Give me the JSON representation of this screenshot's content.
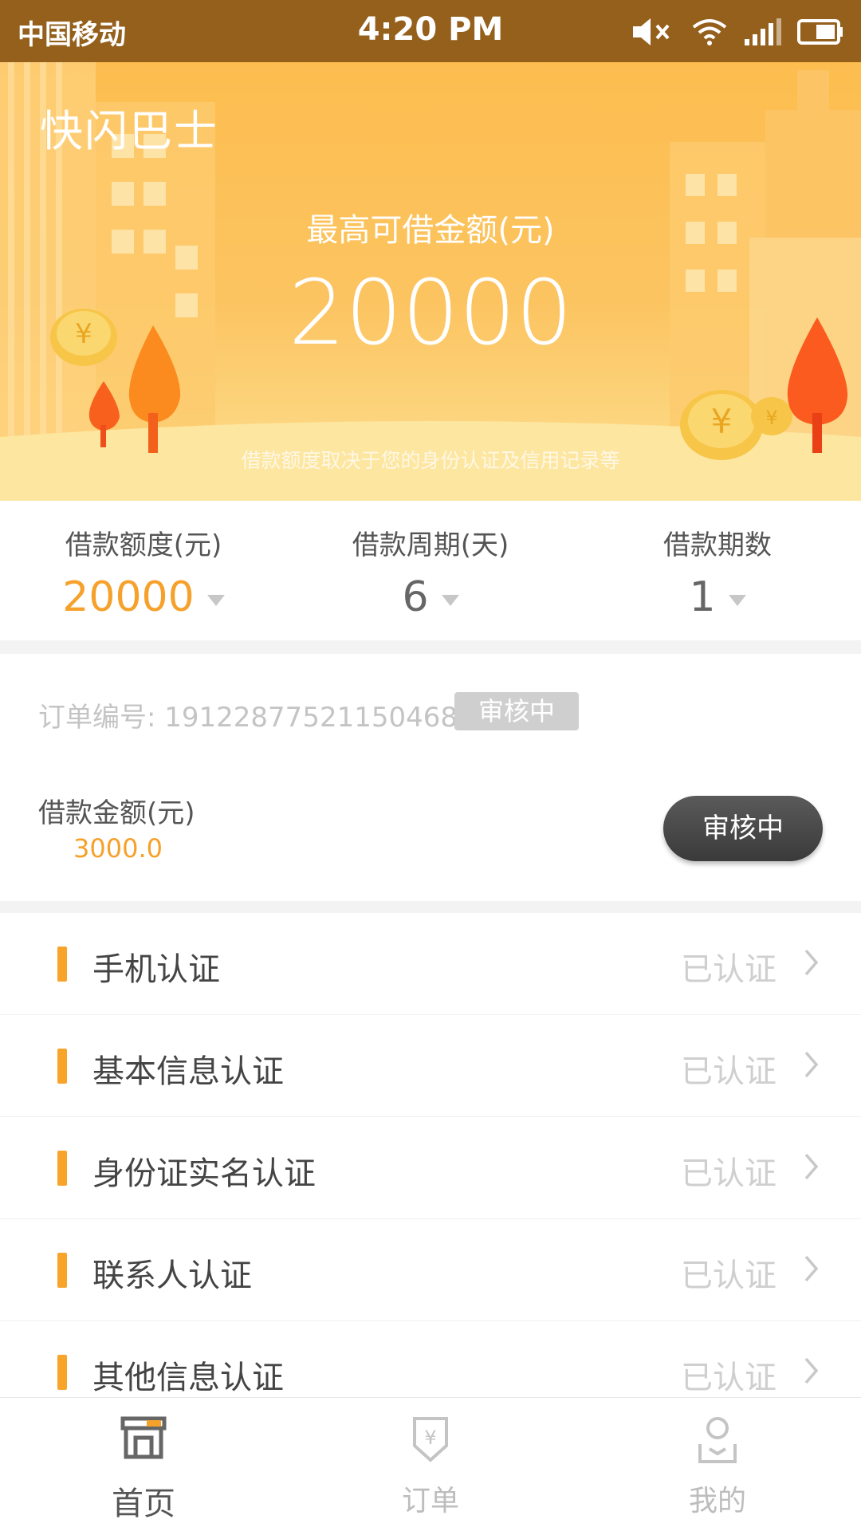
{
  "status_bar": {
    "carrier": "中国移动",
    "time": "4:20 PM"
  },
  "hero": {
    "app_title": "快闪巴士",
    "max_label": "最高可借金额(元)",
    "max_amount": "20000",
    "note": "借款额度取决于您的身份认证及信用记录等"
  },
  "selectors": [
    {
      "label": "借款额度(元)",
      "value": "20000"
    },
    {
      "label": "借款周期(天)",
      "value": "6"
    },
    {
      "label": "借款期数",
      "value": "1"
    }
  ],
  "order": {
    "number_text": "订单编号: 19122877521150468",
    "badge": "审核中",
    "amount_label": "借款金额(元)",
    "amount_value": "3000.0",
    "status_button": "审核中"
  },
  "auth_items": [
    {
      "name": "手机认证",
      "state": "已认证"
    },
    {
      "name": "基本信息认证",
      "state": "已认证"
    },
    {
      "name": "身份证实名认证",
      "state": "已认证"
    },
    {
      "name": "联系人认证",
      "state": "已认证"
    },
    {
      "name": "其他信息认证",
      "state": "已认证"
    }
  ],
  "nav": [
    {
      "label": "首页",
      "icon": "store-icon",
      "active": true
    },
    {
      "label": "订单",
      "icon": "yuan-shield-icon",
      "active": false
    },
    {
      "label": "我的",
      "icon": "user-icon",
      "active": false
    }
  ],
  "colors": {
    "status_bar": "#94601c",
    "accent": "#f5a12b",
    "hero": "#fdbd4f"
  }
}
